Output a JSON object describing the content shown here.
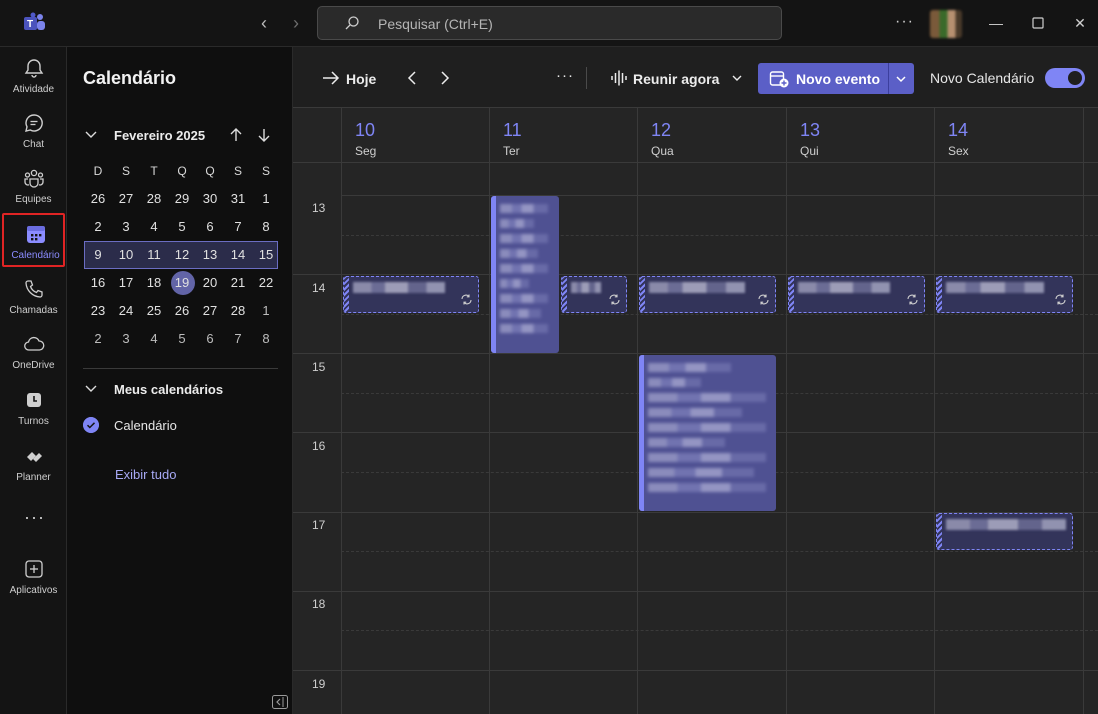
{
  "titlebar": {
    "search_placeholder": "Pesquisar (Ctrl+E)",
    "more": "···"
  },
  "rail": {
    "items": [
      {
        "label": "Atividade",
        "icon": "bell-icon"
      },
      {
        "label": "Chat",
        "icon": "chat-icon"
      },
      {
        "label": "Equipes",
        "icon": "teams-icon"
      },
      {
        "label": "Calendário",
        "icon": "calendar-icon",
        "active": true
      },
      {
        "label": "Chamadas",
        "icon": "phone-icon"
      },
      {
        "label": "OneDrive",
        "icon": "cloud-icon"
      },
      {
        "label": "Turnos",
        "icon": "shifts-icon"
      },
      {
        "label": "Planner",
        "icon": "planner-icon"
      }
    ],
    "more": "···",
    "apps_label": "Aplicativos"
  },
  "panel": {
    "title": "Calendário",
    "month_label": "Fevereiro 2025",
    "weekdays": [
      "D",
      "S",
      "T",
      "Q",
      "Q",
      "S",
      "S"
    ],
    "weeks": [
      [
        "26",
        "27",
        "28",
        "29",
        "30",
        "31",
        "1"
      ],
      [
        "2",
        "3",
        "4",
        "5",
        "6",
        "7",
        "8"
      ],
      [
        "9",
        "10",
        "11",
        "12",
        "13",
        "14",
        "15"
      ],
      [
        "16",
        "17",
        "18",
        "19",
        "20",
        "21",
        "22"
      ],
      [
        "23",
        "24",
        "25",
        "26",
        "27",
        "28",
        "1"
      ],
      [
        "2",
        "3",
        "4",
        "5",
        "6",
        "7",
        "8"
      ]
    ],
    "my_calendars": "Meus calendários",
    "calendar_name": "Calendário",
    "show_all": "Exibir tudo"
  },
  "toolbar": {
    "today": "Hoje",
    "more": "···",
    "meet_now": "Reunir agora",
    "new_event": "Novo evento",
    "new_calendar": "Novo Calendário"
  },
  "week": {
    "days": [
      {
        "num": "10",
        "name": "Seg"
      },
      {
        "num": "11",
        "name": "Ter"
      },
      {
        "num": "12",
        "name": "Qua"
      },
      {
        "num": "13",
        "name": "Qui"
      },
      {
        "num": "14",
        "name": "Sex"
      }
    ],
    "hours": [
      "13",
      "14",
      "15",
      "16",
      "17",
      "18",
      "19"
    ]
  },
  "colors": {
    "accent": "#7f85f5",
    "event_fill": "#33345a",
    "event_solid": "#4f5192",
    "primary_button": "#5b5fc7",
    "active_outline": "#e02424"
  }
}
